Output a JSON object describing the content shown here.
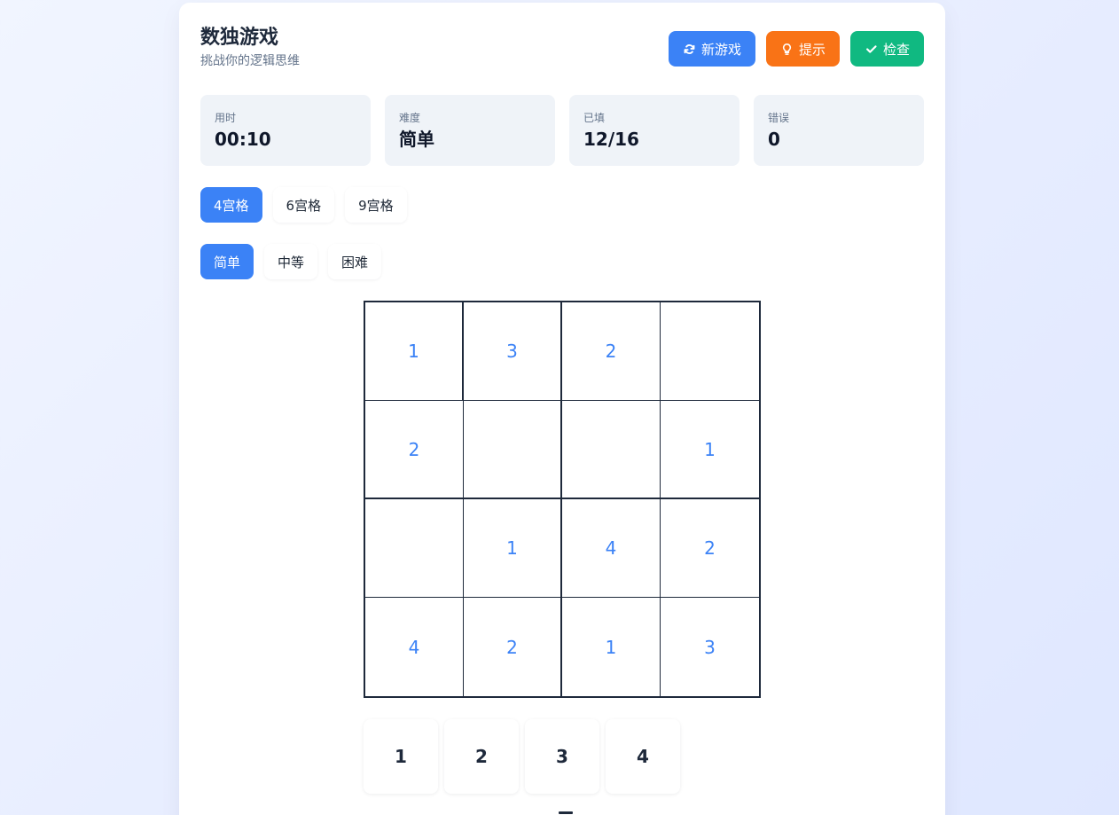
{
  "header": {
    "title": "数独游戏",
    "subtitle": "挑战你的逻辑思维",
    "actions": {
      "new_game": "新游戏",
      "hint": "提示",
      "check": "检查"
    }
  },
  "stats": [
    {
      "label": "用时",
      "value": "00:10"
    },
    {
      "label": "难度",
      "value": "简单"
    },
    {
      "label": "已填",
      "value": "12/16"
    },
    {
      "label": "错误",
      "value": "0"
    }
  ],
  "sizes": [
    "4宫格",
    "6宫格",
    "9宫格"
  ],
  "difficulties": [
    "简单",
    "中等",
    "困难"
  ],
  "board": [
    [
      "1",
      "3",
      "2",
      ""
    ],
    [
      "2",
      "",
      "",
      "1"
    ],
    [
      "",
      "1",
      "4",
      "2"
    ],
    [
      "4",
      "2",
      "1",
      "3"
    ]
  ],
  "numpad": [
    "1",
    "2",
    "3",
    "4"
  ],
  "colors": {
    "accent": "#3b82f6",
    "hint": "#f97316",
    "check": "#10b981"
  }
}
